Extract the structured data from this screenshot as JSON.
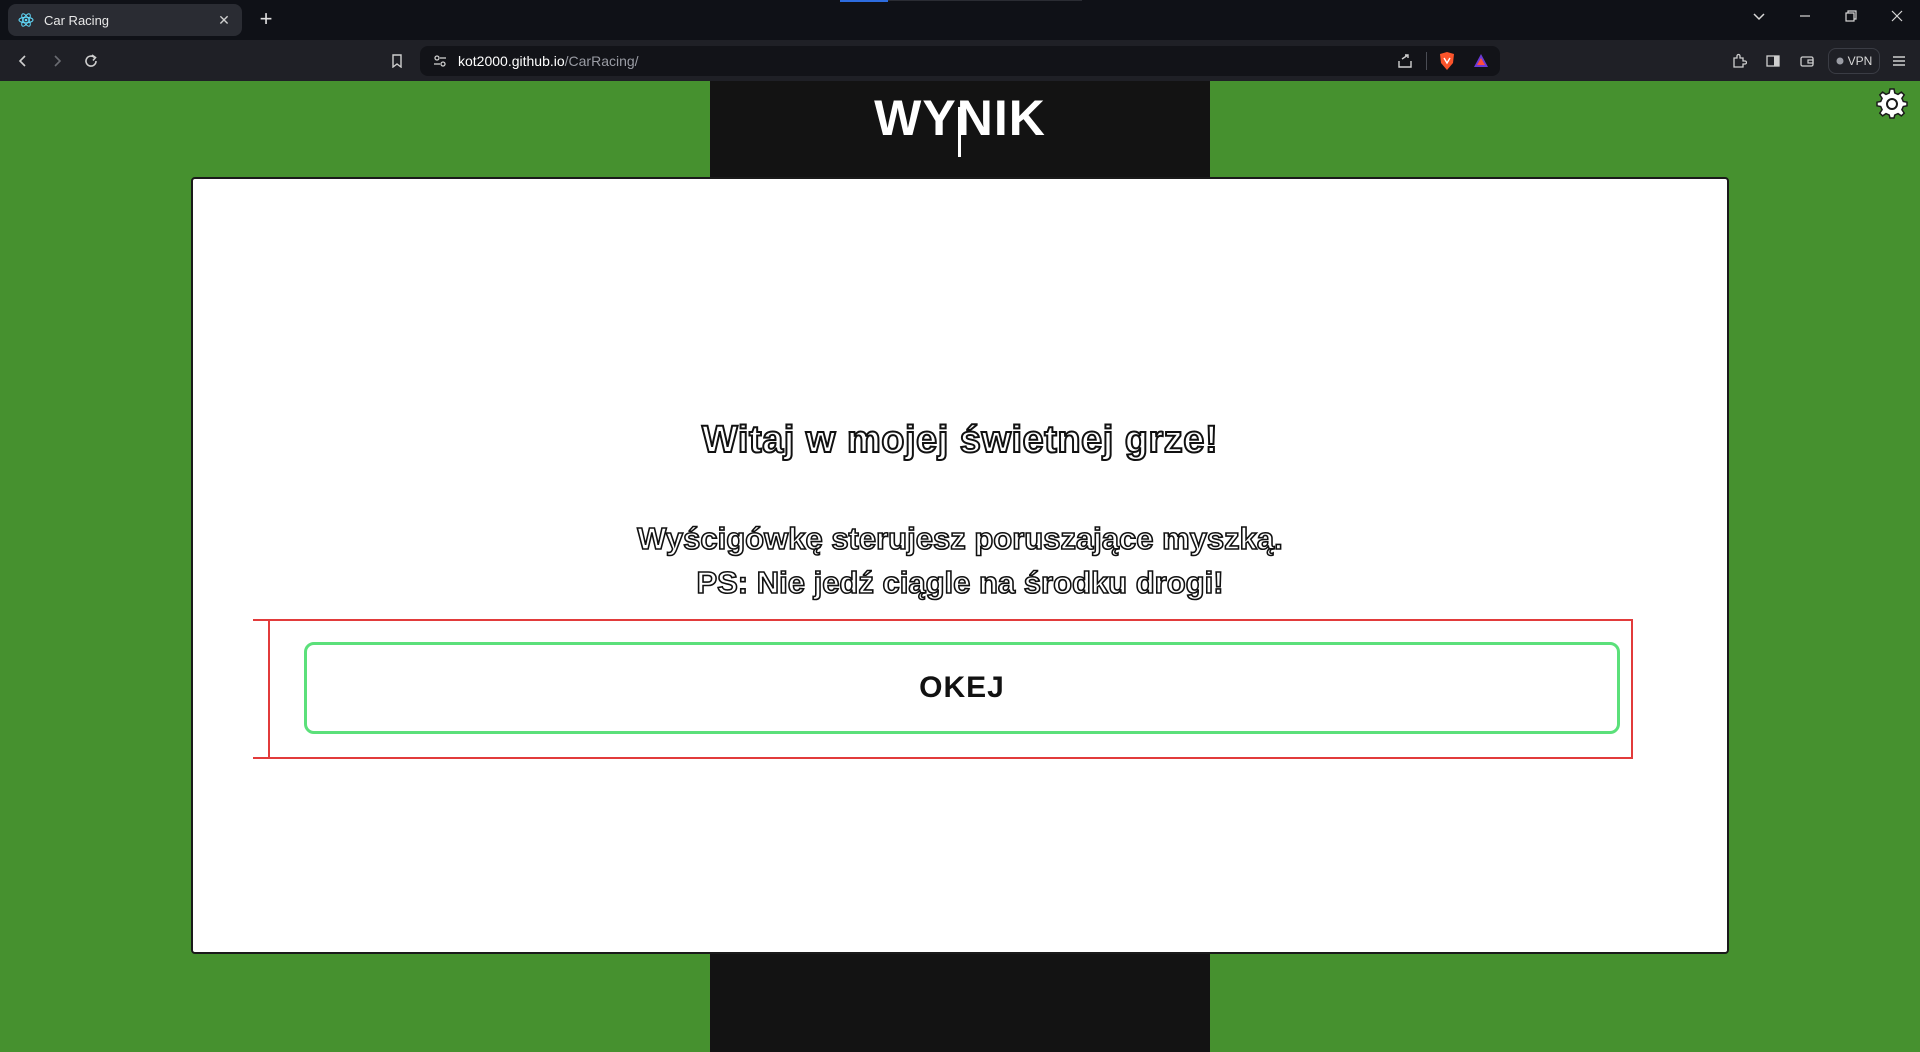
{
  "browser": {
    "tab_title": "Car Racing",
    "url_domain": "kot2000.github.io",
    "url_path": "/CarRacing/",
    "vpn_label": "VPN"
  },
  "game": {
    "score_label": "WYNIK"
  },
  "modal": {
    "heading": "Witaj w mojej świetnej grze!",
    "instruction_line1": "Wyścigówkę sterujesz poruszające myszką.",
    "instruction_line2": "PS: Nie jedź ciągle na środku drogi!",
    "ok_button": "OKEJ"
  },
  "colors": {
    "grass": "#46912f",
    "road": "#131313",
    "button_border": "#5be07a",
    "debug_frame": "#e23b3b"
  }
}
